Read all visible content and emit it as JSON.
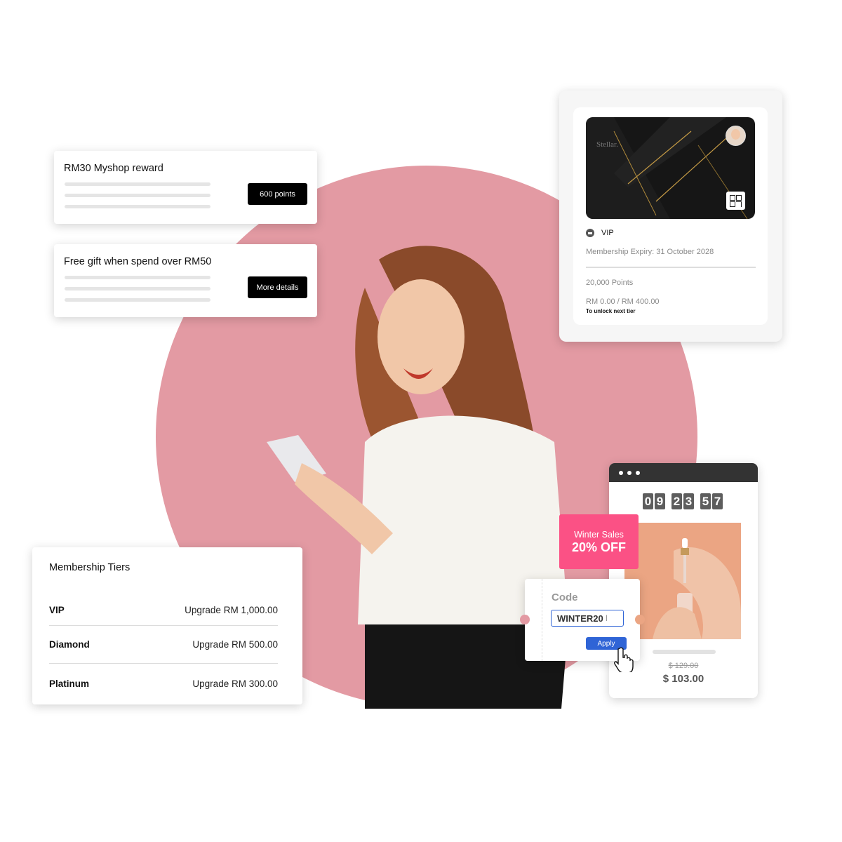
{
  "rewards": [
    {
      "title": "RM30 Myshop reward",
      "button": "600 points"
    },
    {
      "title": "Free gift when spend over RM50",
      "button": "More details"
    }
  ],
  "membership_card": {
    "brand": "Stellar.",
    "tier_icon": "crown-icon",
    "tier": "VIP",
    "expiry": "Membership Expiry: 31 October 2028",
    "points": "20,000 Points",
    "spend_progress": "RM 0.00 / RM 400.00",
    "progress_note": "To unlock next tier",
    "icons": [
      "avatar",
      "qr-code-icon"
    ]
  },
  "tiers": {
    "title": "Membership Tiers",
    "rows": [
      {
        "name": "VIP",
        "value": "Upgrade RM 1,000.00"
      },
      {
        "name": "Diamond",
        "value": "Upgrade RM 500.00"
      },
      {
        "name": "Platinum",
        "value": "Upgrade RM 300.00"
      }
    ]
  },
  "sale": {
    "countdown": [
      "0",
      "9",
      "2",
      "3",
      "5",
      "7"
    ],
    "promo_line1": "Winter Sales",
    "promo_line2": "20% OFF",
    "code_label": "Code",
    "code_value": "WINTER20",
    "apply_label": "Apply",
    "old_price": "$ 129.00",
    "new_price": "$ 103.00"
  },
  "colors": {
    "circle": "#e39aa3",
    "promo": "#fb5185",
    "apply": "#2f64d6",
    "button_dark": "#000000"
  }
}
